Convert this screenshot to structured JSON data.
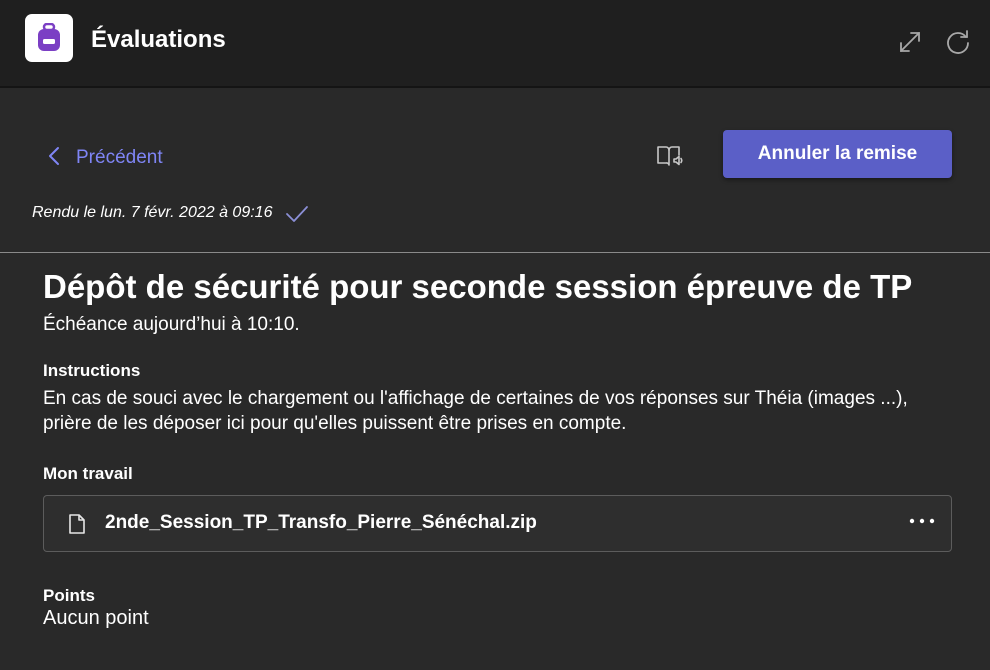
{
  "header": {
    "app_title": "Évaluations",
    "app_icon": "backpack-icon",
    "actions": [
      {
        "name": "expand",
        "icon": "expand-icon"
      },
      {
        "name": "refresh",
        "icon": "refresh-icon"
      }
    ]
  },
  "nav": {
    "back_label": "Précédent",
    "reader_icon": "immersive-reader-icon",
    "unsubmit_label": "Annuler la remise"
  },
  "status": {
    "submitted_text": "Rendu le lun. 7 févr. 2022 à 09:16"
  },
  "assignment": {
    "title": "Dépôt de sécurité pour seconde session épreuve de TP",
    "due": "Échéance aujourd’hui à 10:10.",
    "instructions_label": "Instructions",
    "instructions_text": "En cas de souci avec le chargement ou l'affichage de certaines de vos réponses sur Théia (images ...), prière de les déposer ici pour qu'elles puissent être prises en compte.",
    "work_label": "Mon travail",
    "file_name": "2nde_Session_TP_Transfo_Pierre_Sénéchal.zip",
    "points_label": "Points",
    "points_value": "Aucun point"
  },
  "colors": {
    "accent": "#5b5fc7",
    "link": "#7f85f5",
    "background": "#292929",
    "topbar": "#1f1f1f"
  }
}
